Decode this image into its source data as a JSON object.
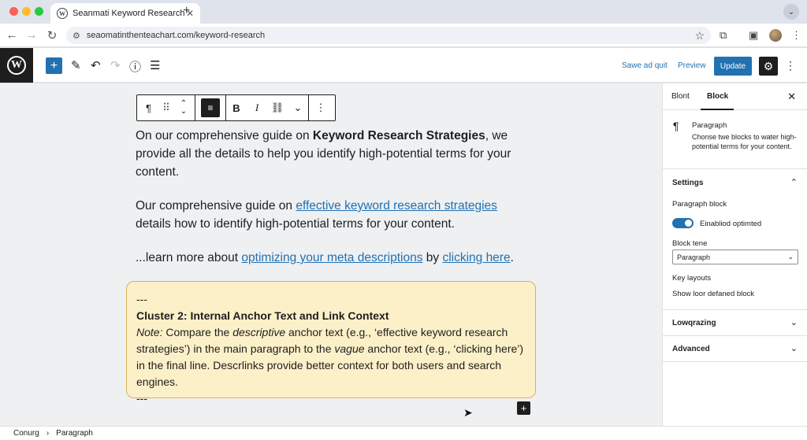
{
  "browser": {
    "tab_title": "Seanmati Keyword Research",
    "url": "seaomatinthenteachart.com/keyword-research"
  },
  "editor_header": {
    "save_draft_label": "Sawe ad quit",
    "preview_label": "Preview",
    "update_label": "Update"
  },
  "block_toolbar": {
    "paragraph_glyph": "¶",
    "bold_glyph": "B",
    "italic_glyph": "I"
  },
  "content": {
    "p1": {
      "before": "On our comprehensive guide on ",
      "bold": "Keyword Research Strategies",
      "after": ", we provide all the details to help you identify high-potential terms for your content."
    },
    "p2": {
      "before": "Our comprehensive guide on ",
      "link": "effective keyword research strategies",
      "after": " details how to identify high-potential terms for your content."
    },
    "p3": {
      "before": "...learn more about ",
      "link1": "optimizing your meta descriptions",
      "middle": " by ",
      "link2": "clicking here",
      "after": "."
    },
    "note": {
      "divider_top": "---",
      "heading": "Cluster 2: Internal Anchor Text and Link Context",
      "note_label": "Note:",
      "t1": " Compare the ",
      "em1": "descriptive",
      "t2": " anchor text (e.g., ‘effective keyword research strategies’) in the main paragraph to the ",
      "em2": "vague",
      "t3": " anchor text (e.g., ‘clicking here’) in the final line. Descrlinks provide better context for both users and search engines.",
      "divider_bottom": "---"
    }
  },
  "sidebar": {
    "tab_post": "Blont",
    "tab_block": "Block",
    "block_name": "Paragraph",
    "block_desc": "Chonse twe blocks to water high-potential terms for your content.",
    "settings_title": "Settings",
    "paragraph_block_label": "Paragraph block",
    "toggle_label": "Einabliod optimted",
    "toggle_on": true,
    "block_tone_label": "Block tene",
    "block_tone_value": "Paragraph",
    "key_layouts_label": "Key layouts",
    "show_label": "Show loor defaned block",
    "panel_lowgrading": "Lowqrazing",
    "panel_advanced": "Advanced"
  },
  "breadcrumb": {
    "root": "Conurg",
    "current": "Paragraph"
  },
  "colors": {
    "accent": "#2271b1",
    "note_bg": "#fcf0c8",
    "note_border": "#d9b45a"
  }
}
